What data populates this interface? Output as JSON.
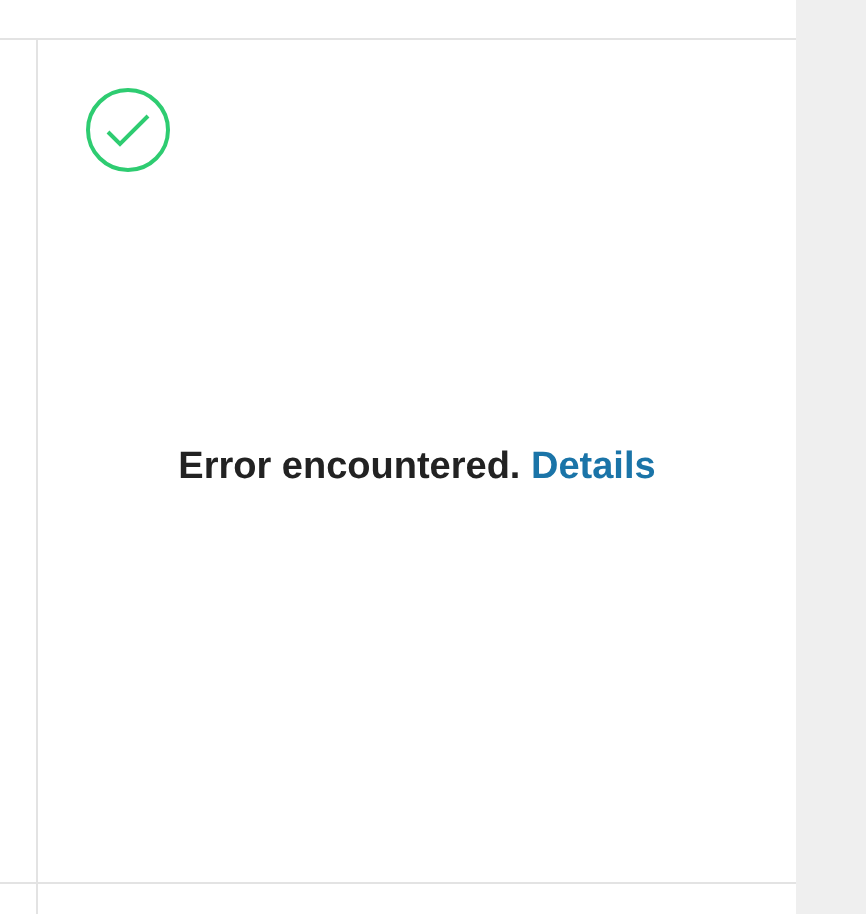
{
  "message": {
    "text": "Error encountered.",
    "link": "Details"
  }
}
